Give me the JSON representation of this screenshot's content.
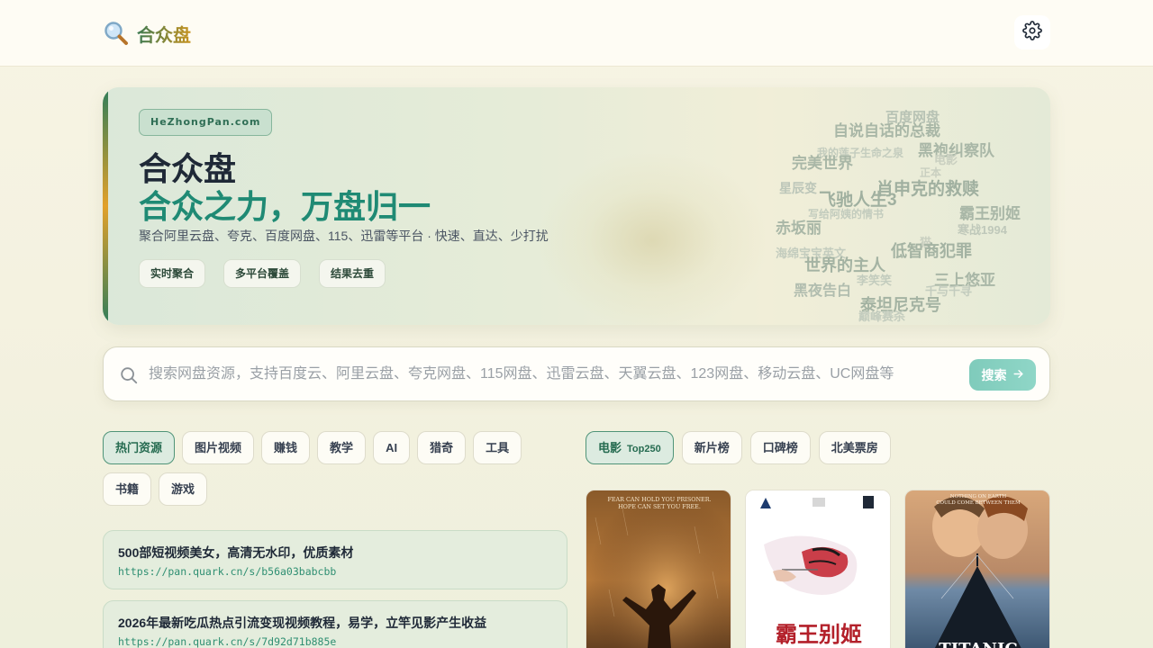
{
  "header": {
    "brand_name": "合众盘",
    "brand_icon": "magnifier-icon",
    "settings_icon": "gear-icon"
  },
  "hero": {
    "domain": "HeZhongPan.com",
    "title": "合众盘",
    "slogan": "合众之力，万盘归一",
    "description": "聚合阿里云盘、夸克、百度网盘、115、迅雷等平台 · 快速、直达、少打扰",
    "tags": [
      "实时聚合",
      "多平台覆盖",
      "结果去重"
    ],
    "word_cloud": [
      "百度网盘",
      "自说自话的总裁",
      "黑袍纠察队",
      "我的莲子生命之泉",
      "电影",
      "完美世界",
      "正本",
      "星辰变",
      "飞驰人生3",
      "肖申克的救赎",
      "写给阿姨的情书",
      "霸王别姬",
      "赤坂丽",
      "寒战1994",
      "海绵宝宝英文",
      "猫",
      "低智商犯罪",
      "世界的主人",
      "李笑笑",
      "三上悠亚",
      "黑夜告白",
      "千与千寻",
      "泰坦尼克号",
      "巅峰赛杀"
    ]
  },
  "search": {
    "placeholder": "搜索网盘资源，支持百度云、阿里云盘、夸克网盘、115网盘、迅雷云盘、天翼云盘、123网盘、移动云盘、UC网盘等",
    "button_label": "搜索",
    "value": ""
  },
  "categories": {
    "items": [
      "热门资源",
      "图片视频",
      "赚钱",
      "教学",
      "AI",
      "猎奇",
      "工具",
      "书籍",
      "游戏"
    ],
    "active": "热门资源"
  },
  "rank_tabs": {
    "items": [
      {
        "label": "电影",
        "sub": "Top250"
      },
      {
        "label": "新片榜",
        "sub": ""
      },
      {
        "label": "口碑榜",
        "sub": ""
      },
      {
        "label": "北美票房",
        "sub": ""
      }
    ],
    "active": "电影"
  },
  "resources": [
    {
      "title": "500部短视频美女，高清无水印，优质素材",
      "link": "https://pan.quark.cn/s/b56a03babcbb"
    },
    {
      "title": "2026年最新吃瓜热点引流变现视频教程，易学，立竿见影产生收益",
      "link": "https://pan.quark.cn/s/7d92d71b885e"
    }
  ],
  "posters": [
    {
      "name": "shawshank-poster",
      "caption": "FEAR CAN HOLD YOU PRISONER. HOPE CAN SET YOU FREE."
    },
    {
      "name": "farewell-my-concubine-poster",
      "caption": "霸王别姬"
    },
    {
      "name": "titanic-poster",
      "caption": "TITANIC"
    }
  ],
  "colors": {
    "accent": "#1f8a74",
    "brand_green": "#3d6e4b",
    "brand_gold": "#c8931f",
    "search_button": "#8fd6c7"
  }
}
